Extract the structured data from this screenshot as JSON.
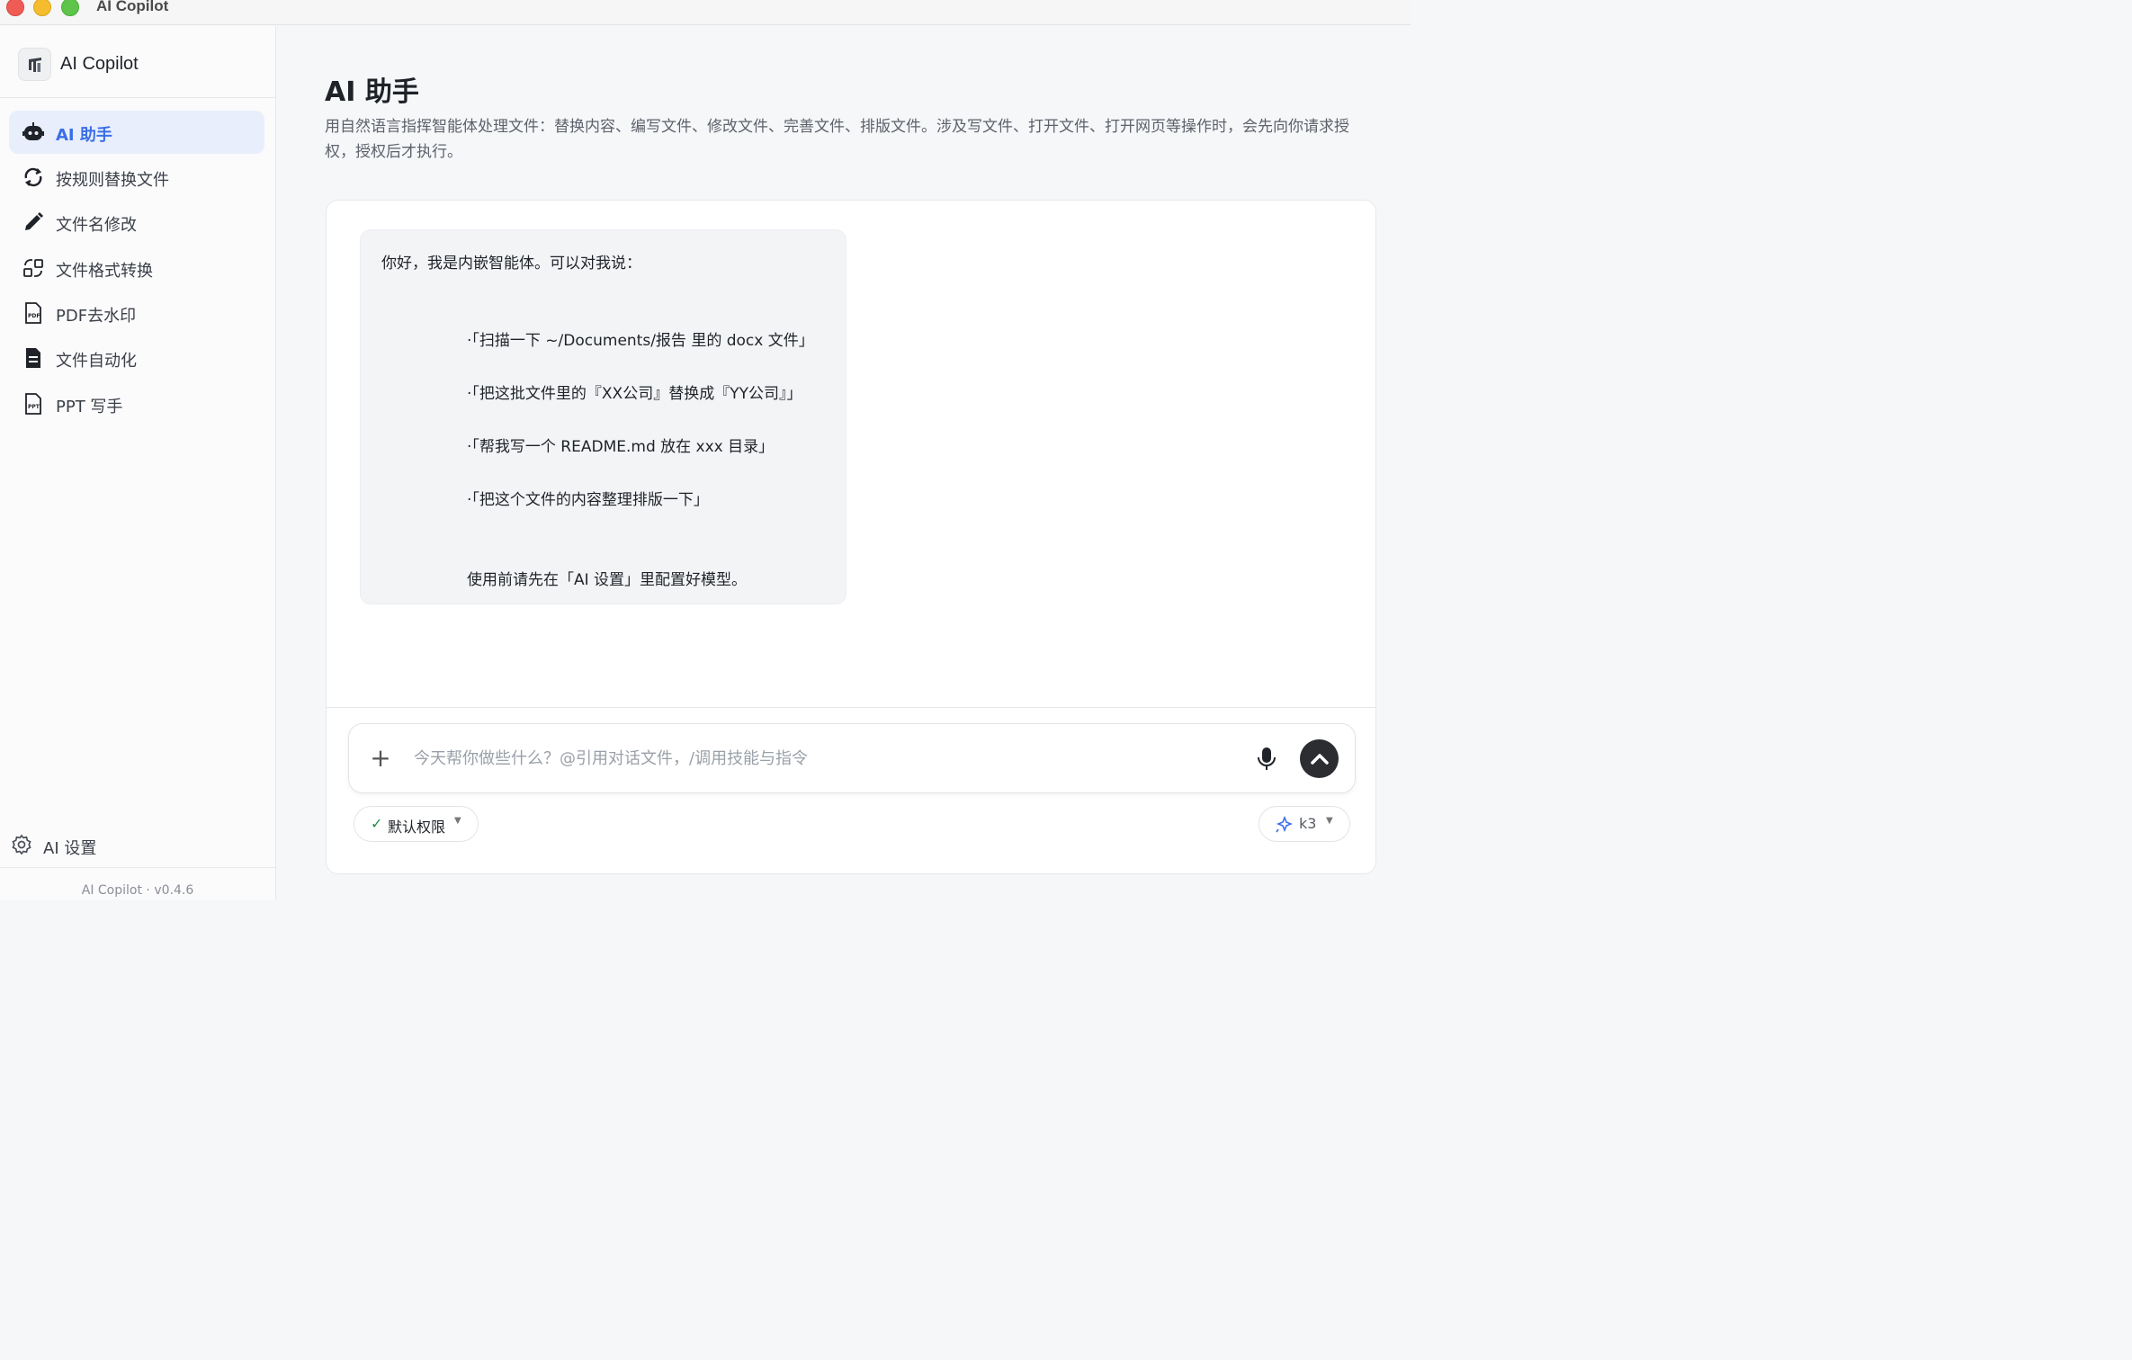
{
  "window": {
    "title": "AI Copilot"
  },
  "sidebar": {
    "brand": "AI Copilot",
    "items": [
      {
        "label": "AI 助手",
        "icon": "robot-icon",
        "active": true
      },
      {
        "label": "按规则替换文件",
        "icon": "refresh-icon",
        "active": false
      },
      {
        "label": "文件名修改",
        "icon": "pencil-icon",
        "active": false
      },
      {
        "label": "文件格式转换",
        "icon": "convert-icon",
        "active": false
      },
      {
        "label": "PDF去水印",
        "icon": "pdf-file-icon",
        "active": false
      },
      {
        "label": "文件自动化",
        "icon": "document-icon",
        "active": false
      },
      {
        "label": "PPT 写手",
        "icon": "ppt-file-icon",
        "active": false
      }
    ],
    "settings_label": "AI 设置",
    "version": "AI Copilot · v0.4.6"
  },
  "main": {
    "title": "AI 助手",
    "description": "用自然语言指挥智能体处理文件：替换内容、编写文件、修改文件、完善文件、排版文件。涉及写文件、打开文件、打开网页等操作时，会先向你请求授权，授权后才执行。"
  },
  "chat": {
    "greeting": "你好，我是内嵌智能体。可以对我说：",
    "examples": [
      "·「扫描一下 ~/Documents/报告 里的 docx 文件」",
      "·「把这批文件里的『XX公司』替换成『YY公司』」",
      "·「帮我写一个 README.md 放在 xxx 目录」",
      "·「把这个文件的内容整理排版一下」"
    ],
    "note": "使用前请先在「AI 设置」里配置好模型。"
  },
  "composer": {
    "placeholder": "今天帮你做些什么？@引用对话文件，/调用技能与指令",
    "value": "",
    "permission_label": "默认权限",
    "model_label": "k3"
  },
  "colors": {
    "accent": "#3a6ee8",
    "active_bg": "#e8eefc",
    "send_button": "#2b2d31",
    "check_green": "#1e8a4c"
  }
}
